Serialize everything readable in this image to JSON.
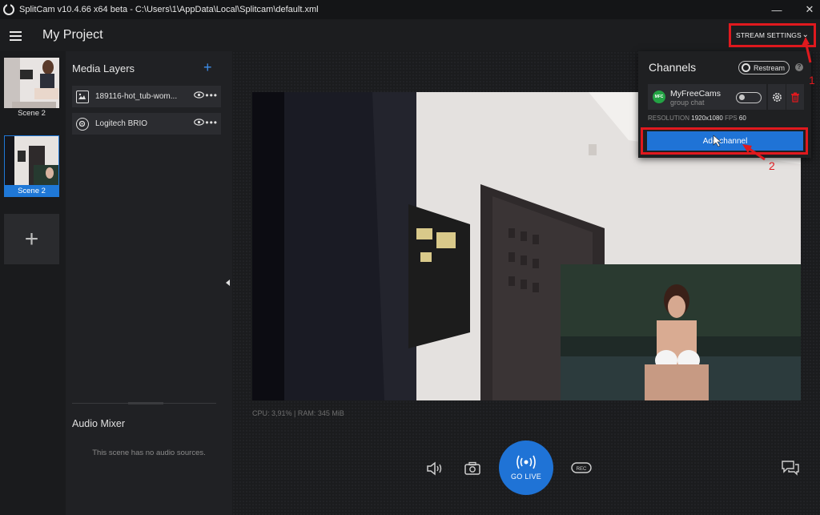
{
  "window": {
    "title": "SplitCam v10.4.66 x64 beta - C:\\Users\\1\\AppData\\Local\\Splitcam\\default.xml",
    "minimize": "—",
    "close": "✕"
  },
  "header": {
    "project_title": "My Project",
    "stream_settings_label": "STREAM SETTINGS"
  },
  "scenes": [
    {
      "label": "Scene 2"
    },
    {
      "label": "Scene 2"
    }
  ],
  "add_scene_label": "+",
  "media_layers": {
    "title": "Media Layers",
    "add_label": "+",
    "items": [
      {
        "name": "189116-hot_tub-wom..."
      },
      {
        "name": "Logitech BRIO"
      }
    ]
  },
  "audio_mixer": {
    "title": "Audio Mixer",
    "empty_text": "This scene has no audio sources."
  },
  "stats": {
    "cpu_ram": "CPU: 3,91% | RAM: 345 MiB"
  },
  "go_live": {
    "label": "GO LIVE"
  },
  "channels_panel": {
    "title": "Channels",
    "restream_label": "Restream",
    "help_label": "?",
    "channels": [
      {
        "name": "MyFreeCams",
        "subtitle": "group chat",
        "logo_text": "MFC",
        "resolution_label": "RESOLUTION",
        "resolution": "1920x1080",
        "fps_label": "FPS",
        "fps": "60"
      }
    ],
    "add_channel_label": "Add channel"
  },
  "annotations": {
    "step1": "1",
    "step2": "2"
  },
  "colors": {
    "accent_blue": "#1f73d6",
    "annotation_red": "#e0191e",
    "mfc_green": "#23a244"
  }
}
